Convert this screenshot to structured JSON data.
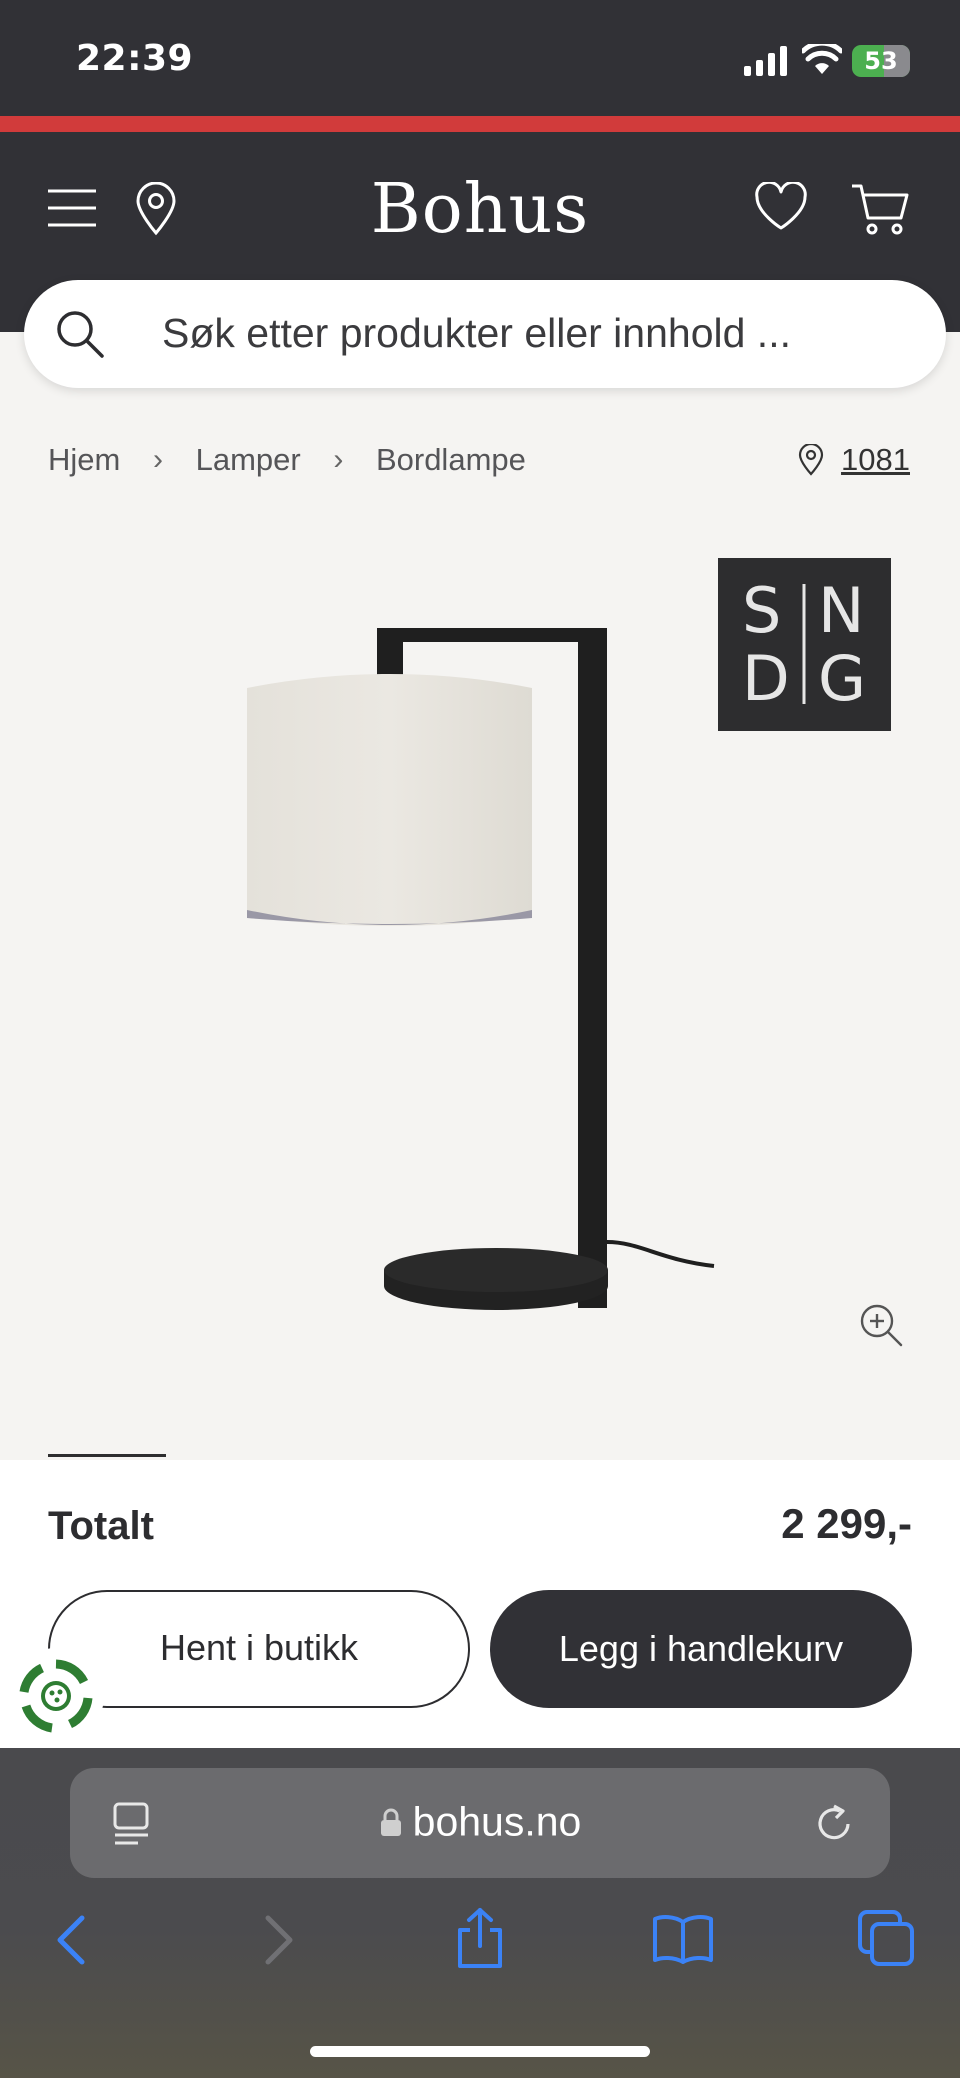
{
  "status_bar": {
    "time": "22:39",
    "battery_percent": "53",
    "signal_icon": "cellular-signal-icon",
    "wifi_icon": "wifi-icon"
  },
  "header": {
    "brand": "Bohus",
    "accent_color": "#d13b3b",
    "background_color": "#313136",
    "icons": [
      "menu-icon",
      "location-pin-icon",
      "heart-icon",
      "cart-icon"
    ]
  },
  "search": {
    "placeholder": "Søk etter produkter eller innhold ..."
  },
  "breadcrumb": {
    "items": [
      "Hjem",
      "Lamper",
      "Bordlampe"
    ],
    "store_number": "1081"
  },
  "product": {
    "brand_badge": {
      "line1_left": "S",
      "line1_right": "N",
      "line2_left": "D",
      "line2_right": "G"
    },
    "image": "table-lamp-black-stand-linen-shade"
  },
  "purchase": {
    "total_label": "Totalt",
    "total_price": "2 299,-",
    "pickup_label": "Hent i butikk",
    "add_to_cart_label": "Legg i handlekurv"
  },
  "browser": {
    "url": "bohus.no",
    "nav_icons": [
      "back-icon",
      "forward-icon",
      "share-icon",
      "bookmarks-icon",
      "tabs-icon"
    ],
    "link_color": "#3b82f6"
  }
}
